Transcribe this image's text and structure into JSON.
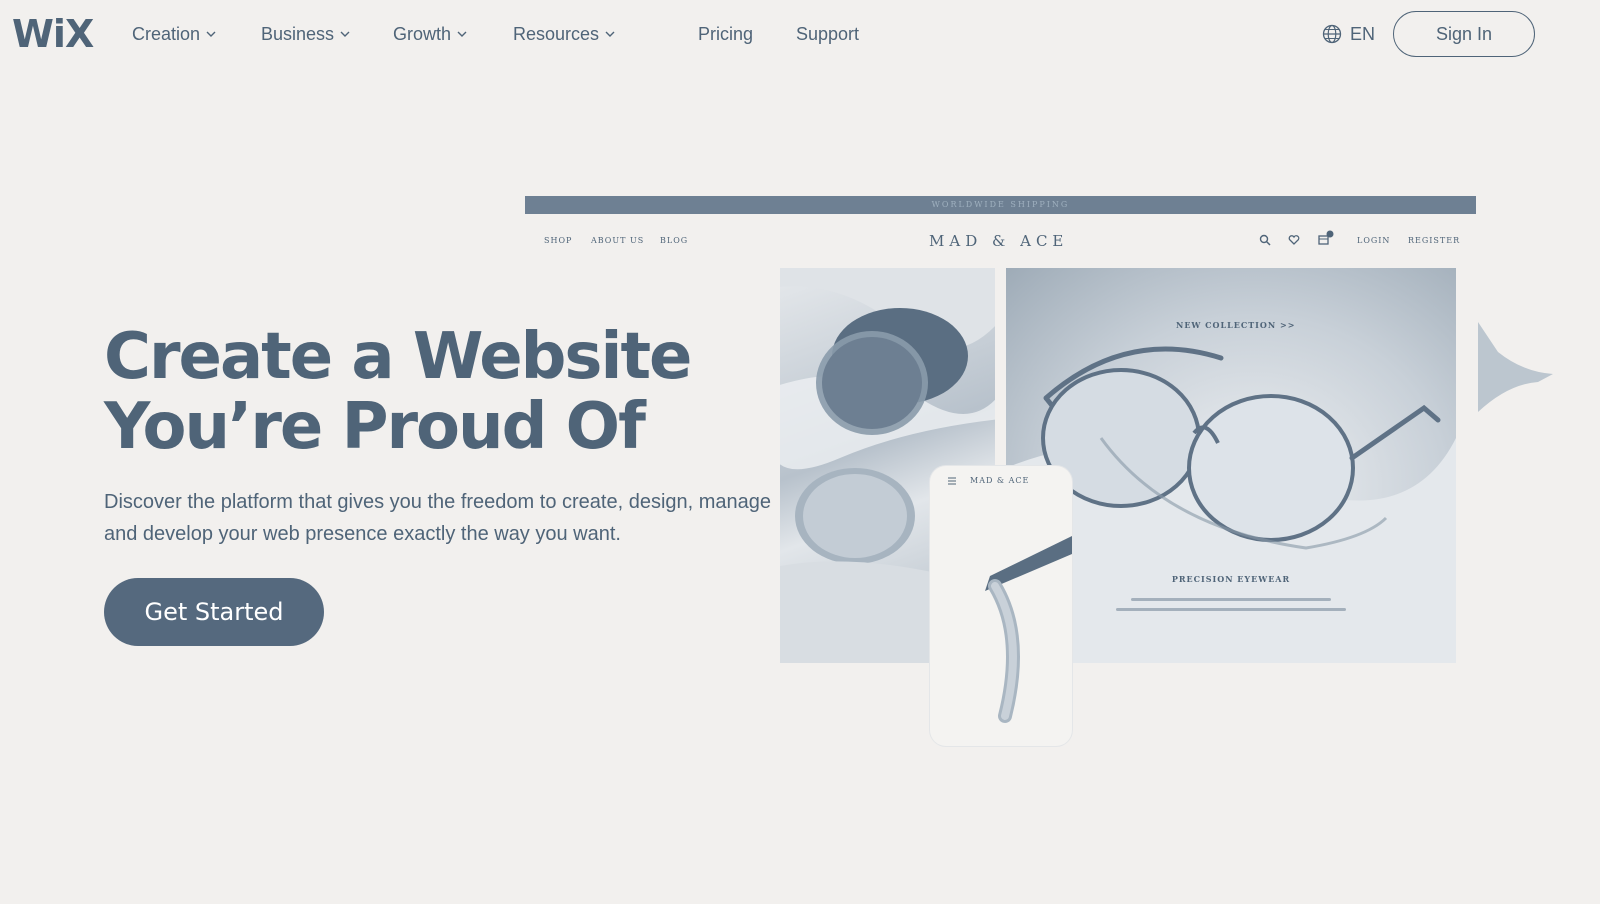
{
  "header": {
    "logo": "WiX",
    "nav": [
      {
        "label": "Creation",
        "has_dropdown": true
      },
      {
        "label": "Business",
        "has_dropdown": true
      },
      {
        "label": "Growth",
        "has_dropdown": true
      },
      {
        "label": "Resources",
        "has_dropdown": true
      },
      {
        "label": "Pricing",
        "has_dropdown": false
      },
      {
        "label": "Support",
        "has_dropdown": false
      }
    ],
    "language": "EN",
    "sign_in": "Sign In"
  },
  "hero": {
    "title_line1": "Create a Website",
    "title_line2": "You’re Proud Of",
    "subtitle": "Discover the platform that gives you the freedom to create, design, manage and develop your web presence exactly the way you want.",
    "cta": "Get Started"
  },
  "mockup": {
    "banner": "WORLDWIDE SHIPPING",
    "nav_left": [
      "SHOP",
      "ABOUT US",
      "BLOG"
    ],
    "brand": "MAD & ACE",
    "nav_right": [
      "LOGIN",
      "REGISTER"
    ],
    "cart_count": "0",
    "new_collection": "NEW COLLECTION  >>",
    "product_heading": "PRECISION EYEWEAR",
    "phone_brand": "MAD & ACE"
  },
  "colors": {
    "background": "#f2f0ee",
    "primary": "#4f6478",
    "cta_bg": "#55697e"
  }
}
